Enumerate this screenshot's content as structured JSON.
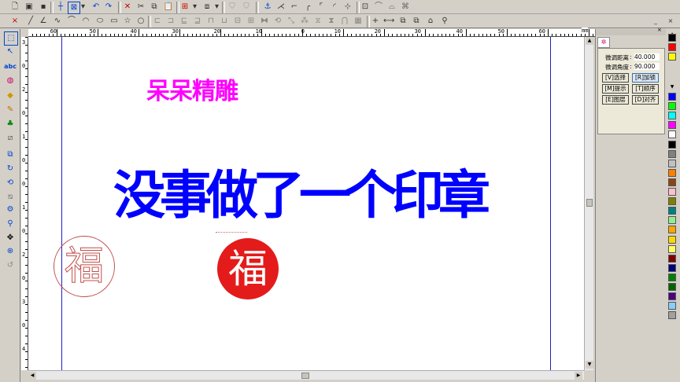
{
  "ruler": {
    "h_ticks": [
      {
        "label": "60",
        "pos": 72
      },
      {
        "label": "50",
        "pos": 122
      },
      {
        "label": "40",
        "pos": 174
      },
      {
        "label": "30",
        "pos": 227
      },
      {
        "label": "20",
        "pos": 280
      },
      {
        "label": "10",
        "pos": 333
      },
      {
        "label": "0",
        "pos": 387
      },
      {
        "label": "10",
        "pos": 433
      },
      {
        "label": "20",
        "pos": 484
      },
      {
        "label": "30",
        "pos": 535
      },
      {
        "label": "40",
        "pos": 588
      },
      {
        "label": "50",
        "pos": 641
      },
      {
        "label": "60",
        "pos": 693
      }
    ],
    "unit": "mm",
    "v_ticks": [
      "3",
      "0",
      "2",
      "0",
      "1",
      "0",
      "0",
      "1",
      "0",
      "2",
      "0",
      "3",
      "0",
      "4"
    ]
  },
  "canvas": {
    "text_small": "呆呆精雕",
    "text_small_color": "#ff00ff",
    "text_large": "没事做了一个印章",
    "text_large_color": "#0000ff",
    "seal_char": "福",
    "seal_outline_color": "#c0504d",
    "seal_fill_color": "#e41b1b"
  },
  "panel": {
    "field1_label": "微调距离",
    "field1_value": "40.000",
    "field2_label": "微调角度",
    "field2_value": "90.000",
    "buttons": [
      "[V]选择",
      "[R]加锁",
      "[M]提示",
      "[T]顺序",
      "[E]图层",
      "[D]对齐"
    ]
  },
  "palette": [
    "#000000",
    "#ff0000",
    "#ffff00",
    "#0000ff",
    "#00ff00",
    "#00ffff",
    "#ff00ff",
    "#ffffff",
    "#000000",
    "#808080",
    "#c0c0c0",
    "#ff7f00",
    "#8b4513",
    "#ffc0cb",
    "#808000",
    "#008080",
    "#90ee90",
    "#ffa500",
    "#ffd700",
    "#ffff66",
    "#800000",
    "#000080",
    "#008000",
    "#006400",
    "#4b0082",
    "#87cefa",
    "#a0a0a0"
  ]
}
